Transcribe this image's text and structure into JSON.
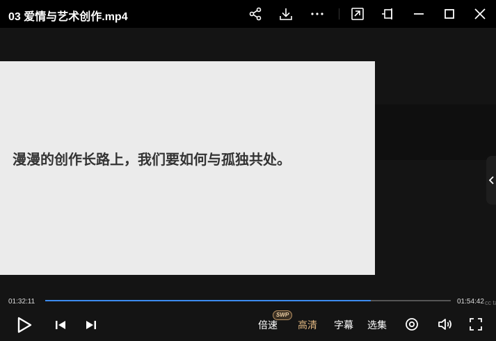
{
  "window": {
    "title": "03 爱情与艺术创作.mp4",
    "icons": [
      "share-icon",
      "download-icon",
      "more-icon",
      "pip-icon",
      "pin-icon",
      "minimize-icon",
      "maximize-icon",
      "close-icon"
    ]
  },
  "video": {
    "slide_text": "漫漫的创作长路上，我们要如何与孤独共处。"
  },
  "playback": {
    "current_time": "01:32:11",
    "total_time": "01:54:42",
    "progress": 0.8036,
    "watermark": "cc tal"
  },
  "controls": {
    "speed_label": "倍速",
    "swp_badge": "SWP",
    "quality_label": "高清",
    "subtitle_label": "字幕",
    "episodes_label": "选集",
    "accent_color": "#e2b882",
    "progress_color": "#3d8cf0"
  }
}
